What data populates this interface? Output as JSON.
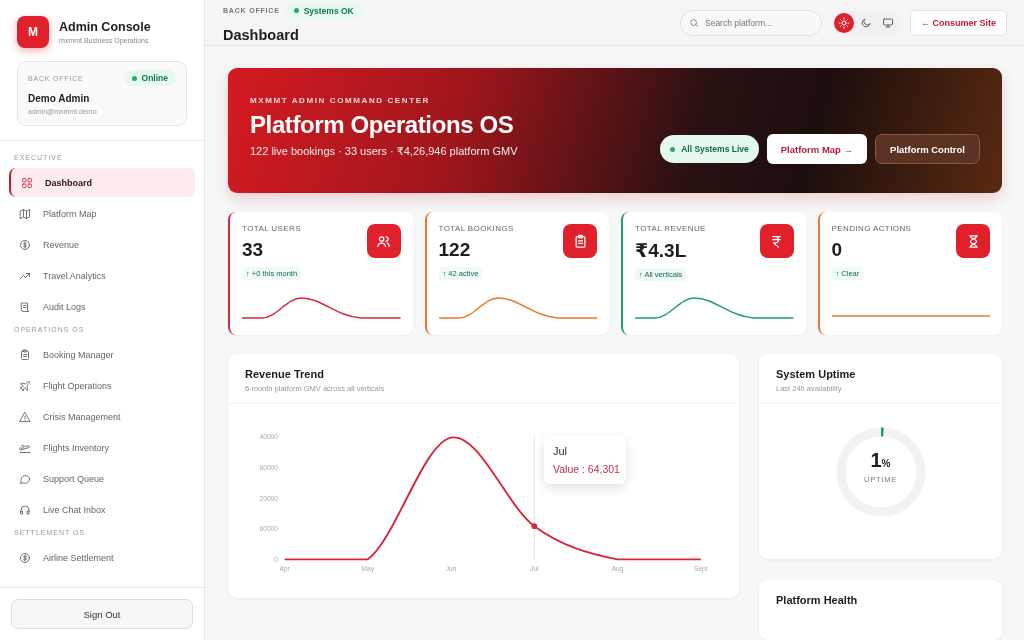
{
  "brand": {
    "logo": "M",
    "title": "Admin Console",
    "subtitle": "mxmmt Business Operations"
  },
  "profile": {
    "label": "BACK OFFICE",
    "status": "Online",
    "name": "Demo Admin",
    "email": "admin@mxmmt.demo"
  },
  "sidebar": {
    "sections": [
      {
        "title": "EXECUTIVE",
        "items": [
          {
            "label": "Dashboard",
            "selected": true
          },
          {
            "label": "Platform Map",
            "selected": false
          },
          {
            "label": "Revenue",
            "selected": false
          },
          {
            "label": "Travel Analytics",
            "selected": false
          },
          {
            "label": "Audit Logs",
            "selected": false
          }
        ]
      },
      {
        "title": "OPERATIONS OS",
        "items": [
          {
            "label": "Booking Manager",
            "selected": false
          },
          {
            "label": "Flight Operations",
            "selected": false
          },
          {
            "label": "Crisis Management",
            "selected": false
          },
          {
            "label": "Flights Inventory",
            "selected": false
          },
          {
            "label": "Support Queue",
            "selected": false
          },
          {
            "label": "Live Chat Inbox",
            "selected": false
          }
        ]
      },
      {
        "title": "SETTLEMENT OS",
        "items": [
          {
            "label": "Airline Settlement",
            "selected": false
          }
        ]
      }
    ]
  },
  "sign_out": "Sign Out",
  "header": {
    "eyebrow": "BACK OFFICE",
    "status": "Systems OK",
    "title": "Dashboard",
    "search_placeholder": "Search platform...",
    "theme_options": [
      {
        "selected": true
      },
      {
        "selected": false
      },
      {
        "selected": false
      }
    ],
    "consumer_link": "← Consumer Site"
  },
  "hero": {
    "eyebrow": "MXMMT ADMIN COMMAND CENTER",
    "title": "Platform Operations OS",
    "subtitle": "122 live bookings · 33 users · ₹4,26,946 platform GMV",
    "status": "All Systems Live",
    "primary_button": "Platform Map →",
    "secondary_button": "Platform Control"
  },
  "stats": [
    {
      "label": "TOTAL USERS",
      "value": "33",
      "delta": "↑ +0 this month",
      "color": "#d7263d"
    },
    {
      "label": "TOTAL BOOKINGS",
      "value": "122",
      "delta": "↑ 42 active",
      "color": "#e8782a"
    },
    {
      "label": "TOTAL REVENUE",
      "value": "₹4.3L",
      "delta": "↑ All verticals",
      "color": "#1f9d6e"
    },
    {
      "label": "PENDING ACTIONS",
      "value": "0",
      "delta": "↑ Clear",
      "color": "#e07b39"
    }
  ],
  "revenue": {
    "title": "Revenue Trend",
    "subtitle": "6-month platform GMV across all verticals",
    "tooltip": {
      "title": "Jul",
      "text": "Value : 64,301"
    },
    "y_axis_labels": [
      "40000",
      "80000",
      "20000",
      "60000",
      "0"
    ],
    "x_axis_labels": [
      "Apr",
      "May",
      "Jun",
      "Jul",
      "Aug",
      "Sept"
    ]
  },
  "uptime": {
    "title": "System Uptime",
    "subtitle": "Last 24h availability",
    "value": "1",
    "unit": "%",
    "caption": "UPTIME",
    "level": 0.01
  },
  "health": {
    "title": "Platform Health"
  }
}
